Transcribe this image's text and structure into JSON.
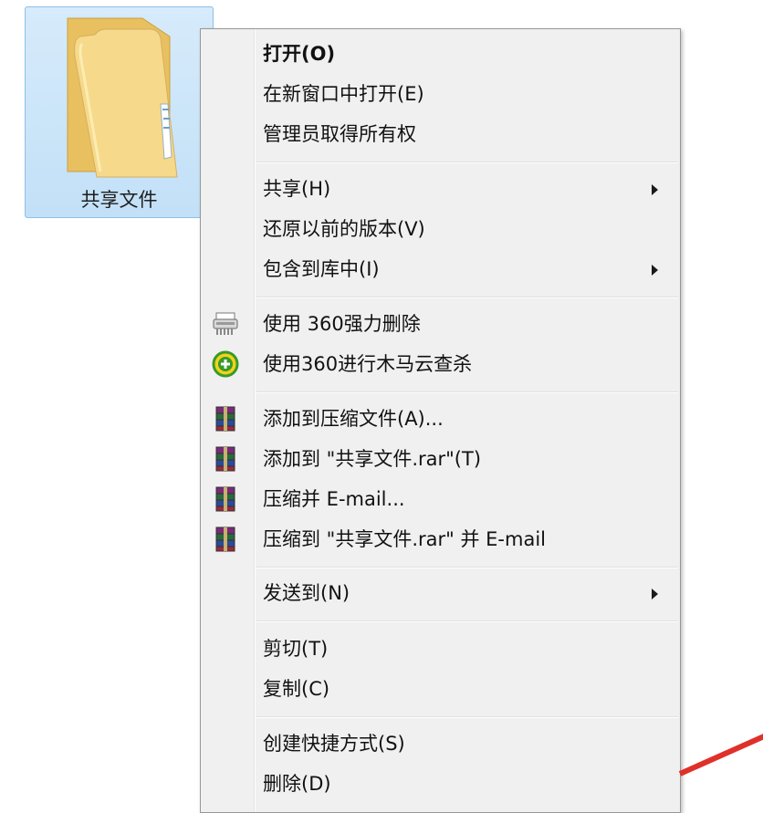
{
  "desktop": {
    "folder_label": "共享文件"
  },
  "context_menu": {
    "group1": {
      "open": "打开(O)",
      "open_new_window": "在新窗口中打开(E)",
      "take_ownership": "管理员取得所有权"
    },
    "group2": {
      "share": "共享(H)",
      "restore_versions": "还原以前的版本(V)",
      "include_in_library": "包含到库中(I)"
    },
    "group3": {
      "force_delete_360": "使用 360强力删除",
      "scan_360": "使用360进行木马云查杀"
    },
    "group4": {
      "add_to_archive": "添加到压缩文件(A)...",
      "add_to_rar": "添加到 \"共享文件.rar\"(T)",
      "compress_email": "压缩并 E-mail...",
      "compress_rar_email": "压缩到 \"共享文件.rar\" 并 E-mail"
    },
    "group5": {
      "send_to": "发送到(N)"
    },
    "group6": {
      "cut": "剪切(T)",
      "copy": "复制(C)"
    },
    "group7": {
      "create_shortcut": "创建快捷方式(S)",
      "delete": "删除(D)"
    }
  },
  "icons": {
    "folder": "folder-icon",
    "shredder": "shredder-icon",
    "antivirus": "360-antivirus-icon",
    "winrar": "winrar-icon",
    "submenu": "submenu-arrow-icon"
  },
  "colors": {
    "menu_bg": "#f0f0f0",
    "selection_bg": "#c2e0f7",
    "folder_yellow": "#f3d27a"
  }
}
